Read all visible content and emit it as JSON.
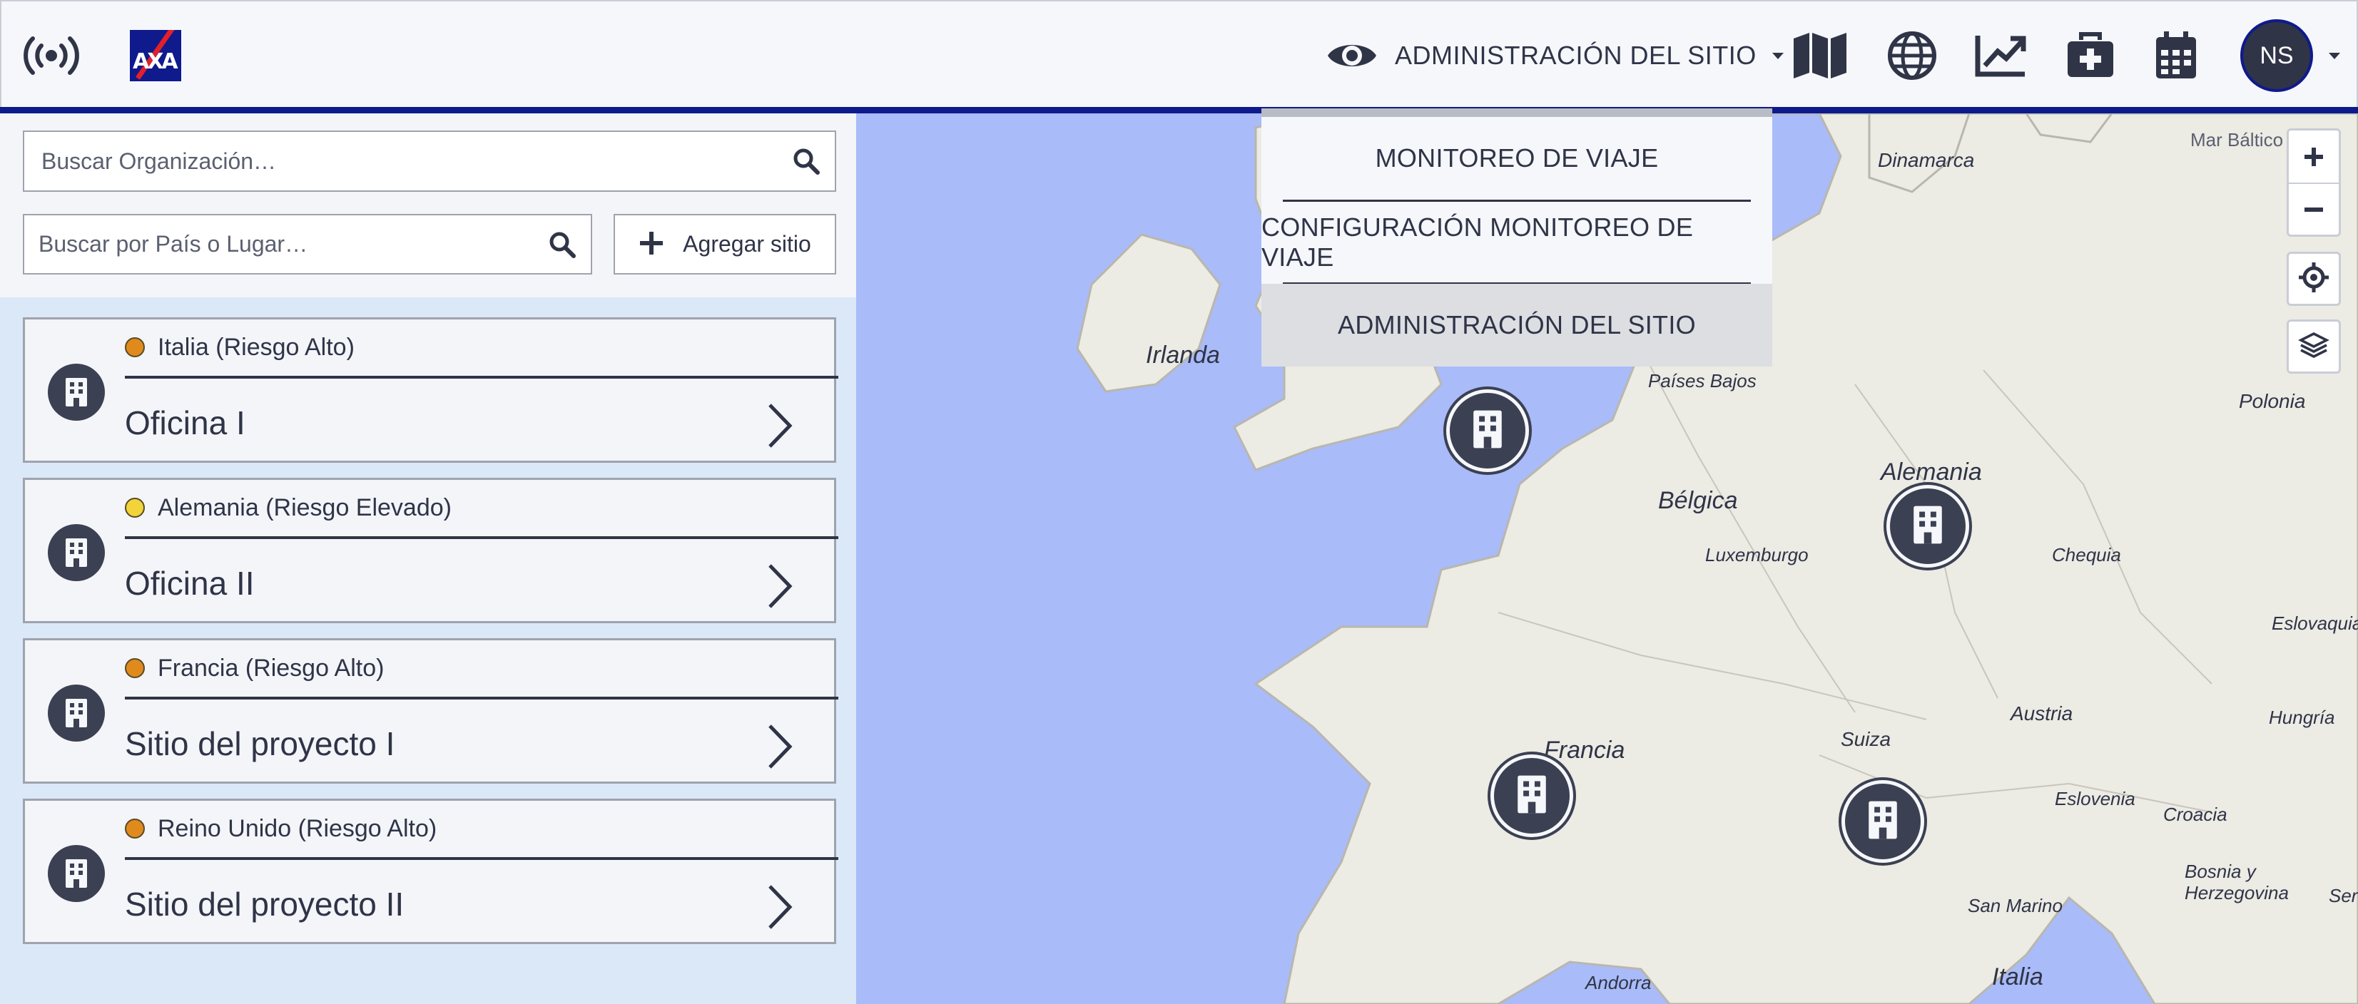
{
  "header": {
    "menu_label": "ADMINISTRACIÓN DEL SITIO",
    "avatar_initials": "NS",
    "brand_logo_text": "AXA",
    "brand_color": "#0f1a8c",
    "icons": [
      "broadcast-icon",
      "axa-logo",
      "eye-icon",
      "map-icon",
      "globe-icon",
      "trend-chart-icon",
      "medical-bag-icon",
      "calendar-icon"
    ]
  },
  "dropdown": {
    "items": [
      {
        "label": "MONITOREO DE VIAJE"
      },
      {
        "label": "CONFIGURACIÓN MONITOREO DE VIAJE"
      },
      {
        "label": "ADMINISTRACIÓN DEL SITIO",
        "active": true
      }
    ]
  },
  "sidebar": {
    "org_search_placeholder": "Buscar Organización…",
    "place_search_placeholder": "Buscar por País o Lugar…",
    "add_site_label": "Agregar sitio",
    "sites": [
      {
        "risk": "Italia (Riesgo Alto)",
        "risk_color": "#e08a1e",
        "name": "Oficina I"
      },
      {
        "risk": "Alemania (Riesgo Elevado)",
        "risk_color": "#f2d43a",
        "name": "Oficina II"
      },
      {
        "risk": "Francia (Riesgo Alto)",
        "risk_color": "#e08a1e",
        "name": "Sitio del proyecto I"
      },
      {
        "risk": "Reino Unido (Riesgo Alto)",
        "risk_color": "#e08a1e",
        "name": "Sitio del proyecto II"
      }
    ]
  },
  "map": {
    "sea_color": "#a9bbf8",
    "land_color": "#ecebe4",
    "labels": {
      "irlanda": "Irlanda",
      "dinamarca": "Dinamarca",
      "mar_baltico": "Mar Báltico",
      "paises_bajos": "Países Bajos",
      "belgica": "Bélgica",
      "luxemburgo": "Luxemburgo",
      "alemania": "Alemania",
      "polonia": "Polonia",
      "chequia": "Chequia",
      "eslovaquia": "Eslovaquia",
      "francia": "Francia",
      "suiza": "Suiza",
      "austria": "Austria",
      "hungria": "Hungría",
      "eslovenia": "Eslovenia",
      "croacia": "Croacia",
      "bosnia": "Bosnia y\nHerzegovina",
      "san_marino": "San Marino",
      "italia": "Italia",
      "andorra": "Andorra",
      "serbia": "Serb"
    },
    "controls": [
      "zoom-in",
      "zoom-out",
      "locate",
      "layers"
    ]
  }
}
